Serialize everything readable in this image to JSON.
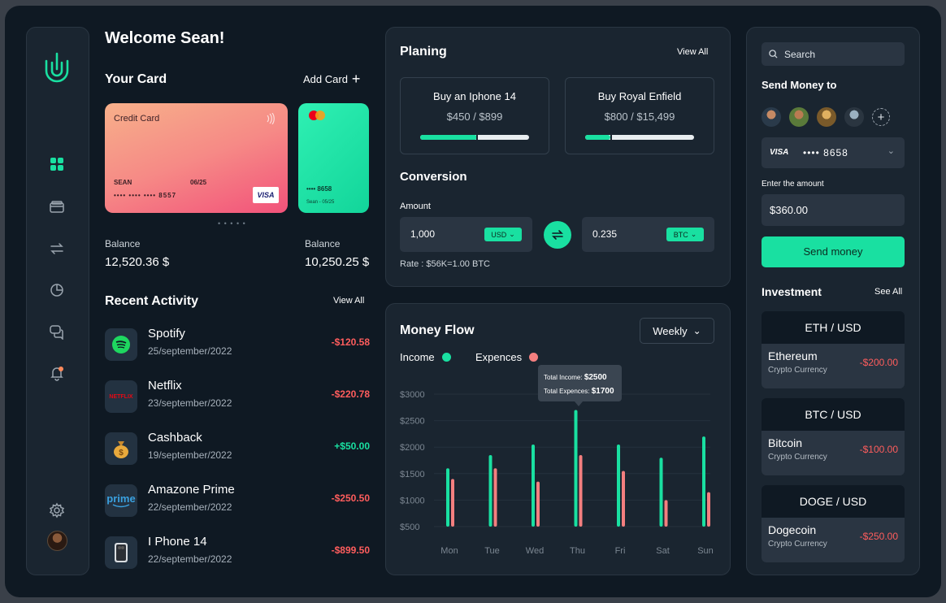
{
  "colors": {
    "accent": "#19e0a1",
    "negative": "#ff5d5d",
    "income": "#19e0a1",
    "expense": "#f47f7f"
  },
  "sidebar": {
    "logo_icon": "u-logo-icon",
    "items": [
      "dashboard-icon",
      "wallet-icon",
      "transfer-icon",
      "pie-chart-icon",
      "chat-icon",
      "bell-icon"
    ],
    "bottom": [
      "gear-icon",
      "avatar"
    ]
  },
  "header": {
    "welcome": "Welcome Sean!"
  },
  "cards": {
    "title": "Your Card",
    "add_label": "Add Card",
    "credit": {
      "label": "Credit Card",
      "holder": "SEAN",
      "expiry": "06/25",
      "number": "•••• •••• •••• 8557",
      "brand": "VISA"
    },
    "second": {
      "number": "•••• 8658",
      "holder_expiry": "Sean - 05/25"
    },
    "dots": "• • • • •",
    "balances": [
      {
        "label": "Balance",
        "value": "12,520.36 $"
      },
      {
        "label": "Balance",
        "value": "10,250.25 $"
      }
    ]
  },
  "activity": {
    "title": "Recent Activity",
    "view_all": "View All",
    "items": [
      {
        "name": "Spotify",
        "date": "25/september/2022",
        "amount": "-$120.58",
        "type": "negative",
        "icon": "spotify-icon"
      },
      {
        "name": "Netflix",
        "date": "23/september/2022",
        "amount": "-$220.78",
        "type": "negative",
        "icon": "netflix-icon",
        "logo_text": "NETFLIX"
      },
      {
        "name": "Cashback",
        "date": "19/september/2022",
        "amount": "+$50.00",
        "type": "positive",
        "icon": "money-bag-icon"
      },
      {
        "name": "Amazone Prime",
        "date": "22/september/2022",
        "amount": "-$250.50",
        "type": "negative",
        "icon": "prime-icon",
        "logo_text": "prime"
      },
      {
        "name": "I Phone 14",
        "date": "22/september/2022",
        "amount": "-$899.50",
        "type": "negative",
        "icon": "iphone-icon"
      }
    ]
  },
  "planning": {
    "title": "Planing",
    "view_all": "View All",
    "goals": [
      {
        "title": "Buy an Iphone 14",
        "value": "$450 / $899",
        "progress": 0.5
      },
      {
        "title": "Buy Royal Enfield",
        "value": "$800 / $15,499",
        "progress": 0.23
      }
    ]
  },
  "conversion": {
    "title": "Conversion",
    "amount_label": "Amount",
    "from": {
      "value": "1,000",
      "currency": "USD"
    },
    "to": {
      "value": "0.235",
      "currency": "BTC"
    },
    "rate": "Rate : $56K=1.00 BTC"
  },
  "money_flow": {
    "title": "Money Flow",
    "period": "Weekly",
    "legend": {
      "income": "Income",
      "expenses": "Expences"
    },
    "tooltip": {
      "income_label": "Total Income:",
      "income_value": "$2500",
      "expense_label": "Total Expences:",
      "expense_value": "$1700"
    }
  },
  "chart_data": {
    "type": "bar",
    "categories": [
      "Mon",
      "Tue",
      "Wed",
      "Thu",
      "Fri",
      "Sat",
      "Sun"
    ],
    "y_ticks": [
      "$3000",
      "$2500",
      "$2000",
      "$1500",
      "$1000",
      "$500"
    ],
    "ylim": [
      500,
      3000
    ],
    "series": [
      {
        "name": "Income",
        "values": [
          1600,
          1850,
          2050,
          2700,
          2050,
          1800,
          2200
        ]
      },
      {
        "name": "Expences",
        "values": [
          1400,
          1600,
          1350,
          1850,
          1550,
          1000,
          1150
        ]
      }
    ]
  },
  "send": {
    "search_placeholder": "Search",
    "title": "Send Money to",
    "card_brand": "VISA",
    "card_number": "•••• 8658",
    "amount_label": "Enter the amount",
    "amount_value": "$360.00",
    "button": "Send money"
  },
  "investment": {
    "title": "Investment",
    "see_all": "See All",
    "items": [
      {
        "pair": "ETH / USD",
        "name": "Ethereum",
        "sub": "Crypto Currency",
        "amount": "-$200.00"
      },
      {
        "pair": "BTC / USD",
        "name": "Bitcoin",
        "sub": "Crypto Currency",
        "amount": "-$100.00"
      },
      {
        "pair": "DOGE / USD",
        "name": "Dogecoin",
        "sub": "Crypto Currency",
        "amount": "-$250.00"
      }
    ]
  }
}
